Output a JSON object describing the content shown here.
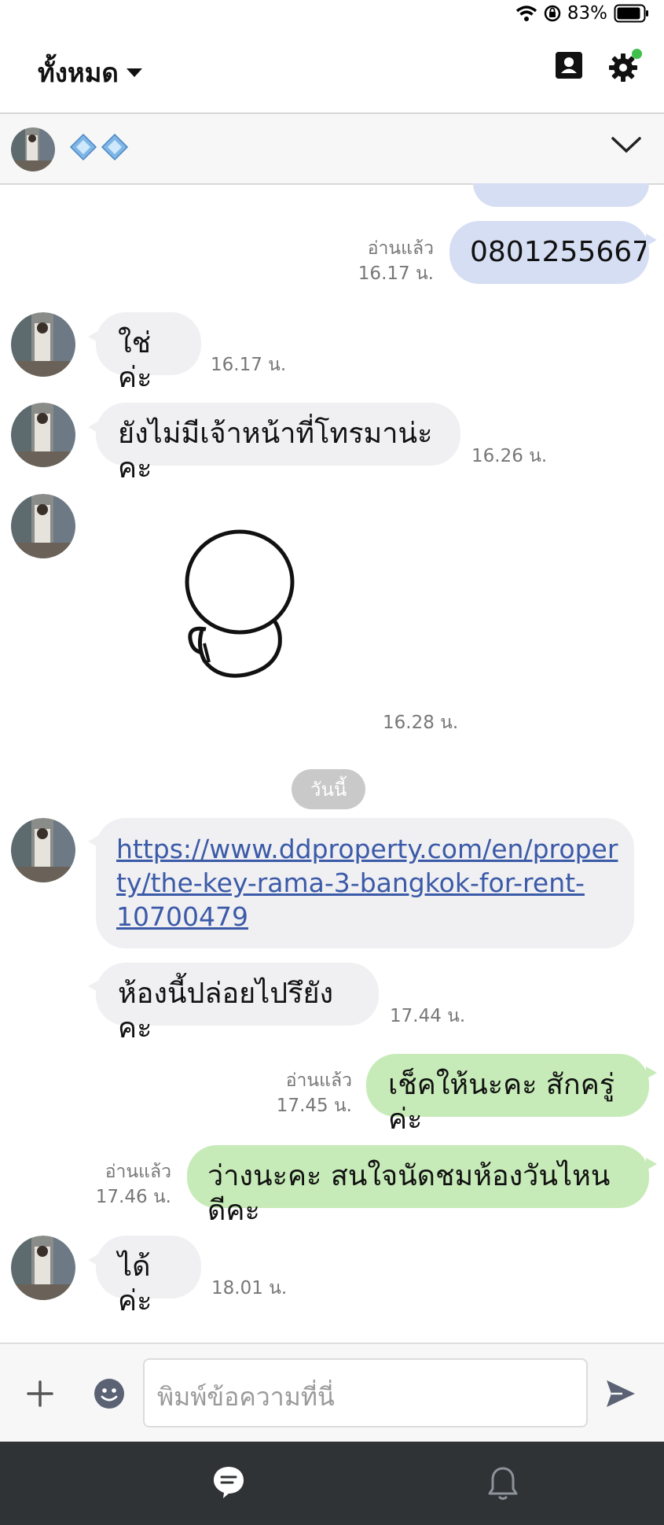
{
  "status_bar": {
    "battery": "83%"
  },
  "header": {
    "title": "ทั้งหมด"
  },
  "chat": {
    "name_symbols": "💠💠"
  },
  "messages": {
    "top_partial_time": "",
    "m1": {
      "text": "0801255667",
      "read": "อ่านแล้ว",
      "time": "16.17 น."
    },
    "m2": {
      "text": "ใช่ค่ะ",
      "time": "16.17 น."
    },
    "m3": {
      "text": "ยังไม่มีเจ้าหน้าที่โทรมาน่ะคะ",
      "time": "16.26 น."
    },
    "m4": {
      "time": "16.28 น."
    },
    "day_separator": "วันนี้",
    "m5": {
      "link": "https://www.ddproperty.com/en/property/the-key-rama-3-bangkok-for-rent-10700479",
      "line1": "https://www.ddproperty.com/en/proper",
      "line2": "ty/the-key-rama-3-bangkok-for-rent-",
      "line3": "10700479"
    },
    "m6": {
      "text": "ห้องนี้ปล่อยไปรึยังคะ",
      "time": "17.44 น."
    },
    "m7": {
      "text": "เช็คให้นะคะ สักครู่ค่ะ",
      "read": "อ่านแล้ว",
      "time": "17.45 น."
    },
    "m8": {
      "text": "ว่างนะคะ สนใจนัดชมห้องวันไหนดีคะ",
      "read": "อ่านแล้ว",
      "time": "17.46 น."
    },
    "m9": {
      "text": "ได้ค่ะ",
      "time": "18.01 น."
    }
  },
  "composer": {
    "placeholder": "พิมพ์ข้อความที่นี่"
  },
  "colors": {
    "out_blue": "#d6def4",
    "out_green": "#c7ebb8",
    "incoming": "#f0f0f2",
    "tabbar": "#2f3336"
  }
}
